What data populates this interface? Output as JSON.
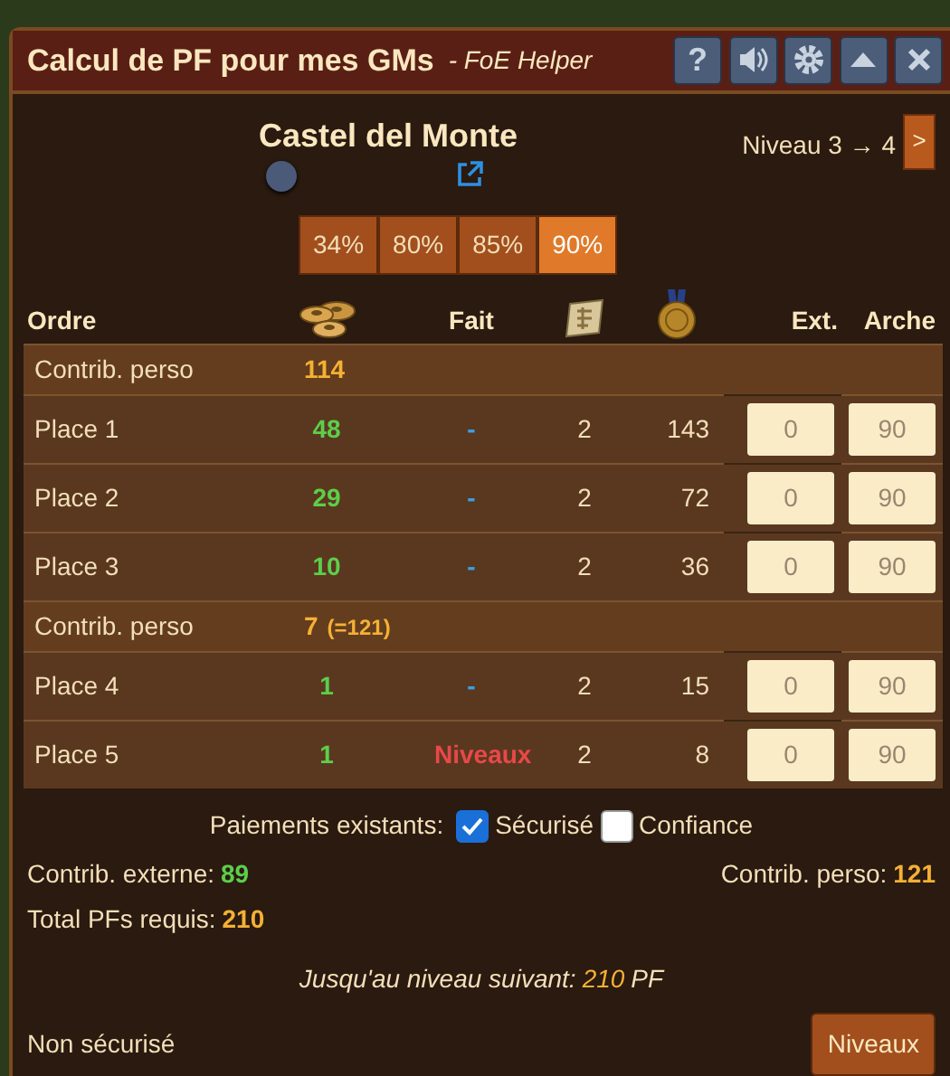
{
  "window": {
    "title": "Calcul de PF pour mes GMs",
    "subtitle": "- FoE Helper",
    "buttons": [
      {
        "kind": "help",
        "label": "?"
      },
      {
        "kind": "sound"
      },
      {
        "kind": "settings"
      },
      {
        "kind": "minimize"
      },
      {
        "kind": "close"
      }
    ]
  },
  "building": {
    "name": "Castel del Monte",
    "level_text": "Niveau 3 → 4",
    "next_label": ">"
  },
  "percent_tabs": [
    {
      "label": "34%",
      "selected": false
    },
    {
      "label": "80%",
      "selected": false
    },
    {
      "label": "85%",
      "selected": false
    },
    {
      "label": "90%",
      "selected": true
    }
  ],
  "table": {
    "columns": [
      {
        "kind": "text",
        "label": "Ordre"
      },
      {
        "kind": "coins"
      },
      {
        "kind": "text",
        "label": "Fait"
      },
      {
        "kind": "blueprint"
      },
      {
        "kind": "medal"
      },
      {
        "kind": "text",
        "label": "Ext."
      },
      {
        "kind": "text",
        "label": "Arche"
      }
    ],
    "rows": [
      {
        "kind": "contrib",
        "label": "Contrib. perso",
        "value": "114"
      },
      {
        "kind": "place",
        "label": "Place 1",
        "pf": "48",
        "fait": {
          "kind": "pending",
          "text": "-"
        },
        "blueprints": "2",
        "medals": "143",
        "ext": "0",
        "arche": "90"
      },
      {
        "kind": "place",
        "label": "Place 2",
        "pf": "29",
        "fait": {
          "kind": "pending",
          "text": "-"
        },
        "blueprints": "2",
        "medals": "72",
        "ext": "0",
        "arche": "90"
      },
      {
        "kind": "place",
        "label": "Place 3",
        "pf": "10",
        "fait": {
          "kind": "pending",
          "text": "-"
        },
        "blueprints": "2",
        "medals": "36",
        "ext": "0",
        "arche": "90"
      },
      {
        "kind": "contrib",
        "label": "Contrib. perso",
        "value": "7",
        "note": "(=121)"
      },
      {
        "kind": "place",
        "label": "Place 4",
        "pf": "1",
        "fait": {
          "kind": "pending",
          "text": "-"
        },
        "blueprints": "2",
        "medals": "15",
        "ext": "0",
        "arche": "90"
      },
      {
        "kind": "place",
        "label": "Place 5",
        "pf": "1",
        "fait": {
          "kind": "alert",
          "text": "Niveaux"
        },
        "blueprints": "2",
        "medals": "8",
        "ext": "0",
        "arche": "90"
      }
    ]
  },
  "payments": {
    "label": "Paiements existants:",
    "options": [
      {
        "label": "Sécurisé",
        "checked": true
      },
      {
        "label": "Confiance",
        "checked": false
      }
    ]
  },
  "summary": {
    "external": {
      "label": "Contrib. externe:",
      "value": "89"
    },
    "personal": {
      "label": "Contrib. perso:",
      "value": "121"
    },
    "total": {
      "label": "Total PFs requis:",
      "value": "210"
    }
  },
  "next_level": {
    "label": "Jusqu'au niveau suivant:",
    "value": "210",
    "unit": "PF"
  },
  "status_bar": {
    "text": "Non sécurisé",
    "button": "Niveaux"
  }
}
